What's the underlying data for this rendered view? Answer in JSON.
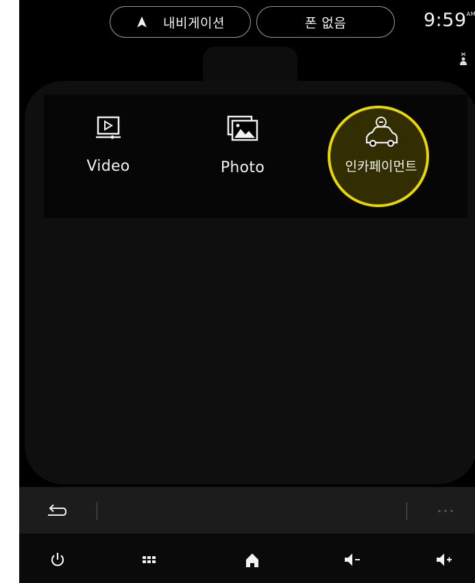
{
  "status_bar": {
    "navigation_label": "내비게이션",
    "phone_label": "폰 없음",
    "clock": "9:59",
    "clock_suffix": "AM"
  },
  "apps": [
    {
      "label": "Video",
      "icon": "video-player-icon"
    },
    {
      "label": "Photo",
      "icon": "photo-gallery-icon"
    },
    {
      "label": "인카페이먼트",
      "icon": "car-payment-icon",
      "highlighted": true
    }
  ],
  "bottom_bar": {
    "back_icon": "back-arrow-icon",
    "more_icon": "more-options-icon",
    "buttons": [
      "power-icon",
      "app-grid-icon",
      "home-icon",
      "volume-down-icon",
      "volume-up-icon"
    ]
  },
  "colors": {
    "highlight": "#e8d800",
    "background": "#000000",
    "text": "#f2f2f2"
  }
}
